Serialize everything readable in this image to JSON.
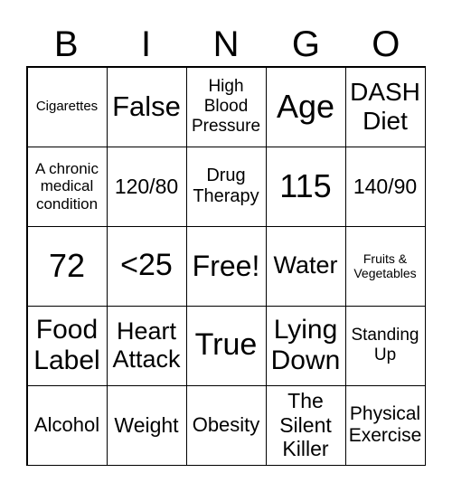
{
  "header": [
    "B",
    "I",
    "N",
    "G",
    "O"
  ],
  "cells": [
    "Cigarettes",
    "False",
    "High\nBlood\nPressure",
    "Age",
    "DASH\nDiet",
    "A chronic\nmedical\ncondition",
    "120/80",
    "Drug\nTherapy",
    "115",
    "140/90",
    "72",
    "<25",
    "Free!",
    "Water",
    "Fruits &\nVegetables",
    "Food\nLabel",
    "Heart\nAttack",
    "True",
    "Lying\nDown",
    "Standing\nUp",
    "Alcohol",
    "Weight",
    "Obesity",
    "The\nSilent\nKiller",
    "Physical\nExercise"
  ]
}
